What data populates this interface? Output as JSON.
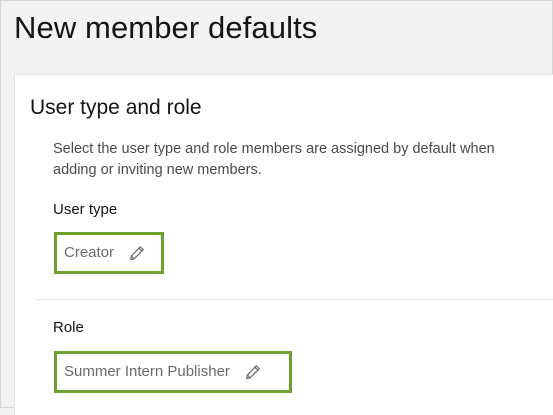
{
  "header": {
    "title": "New member defaults"
  },
  "section": {
    "title": "User type and role",
    "description": "Select the user type and role members are assigned by default when adding or inviting new members.",
    "user_type": {
      "label": "User type",
      "value": "Creator",
      "icon": "pencil-edit-icon"
    },
    "role": {
      "label": "Role",
      "value": "Summer Intern Publisher",
      "icon": "pencil-edit-icon"
    }
  },
  "colors": {
    "highlight_border": "#6ca12e",
    "page_background": "#f2f2f2",
    "card_background": "#ffffff"
  }
}
